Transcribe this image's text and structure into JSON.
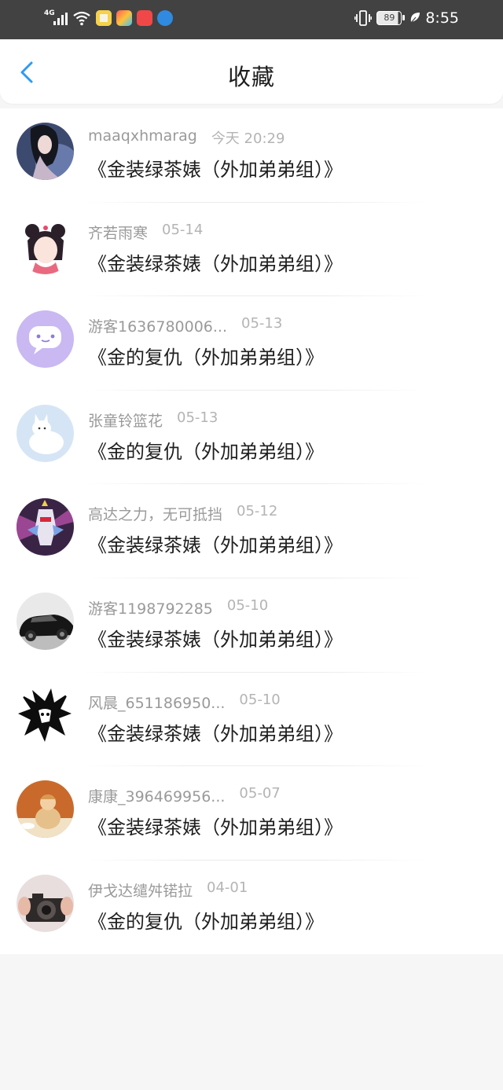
{
  "status_bar": {
    "network": "4G",
    "battery": "89",
    "time": "8:55",
    "icons": [
      "signal-icon",
      "wifi-icon",
      "app-icon-yellow",
      "app-icon-colorful",
      "app-icon-red",
      "app-icon-blue",
      "vibrate-icon",
      "battery-icon",
      "leaf-icon"
    ]
  },
  "header": {
    "title": "收藏",
    "back_icon": "chevron-left-icon"
  },
  "colors": {
    "accent": "#2f9bf0",
    "status_bar": "#424242",
    "page_background": "#f7f6f6"
  },
  "items": [
    {
      "user": "maaqxhmarag",
      "date": "今天 20:29",
      "title": "《金装绿茶婊（外加弟弟组）》",
      "avatar": "avatar-girl-photo"
    },
    {
      "user": "齐若雨寒",
      "date": "05-14",
      "title": "《金装绿茶婊（外加弟弟组）》",
      "avatar": "avatar-anime-girl"
    },
    {
      "user": "游客1636780006...",
      "date": "05-13",
      "title": "《金的复仇（外加弟弟组）》",
      "avatar": "avatar-chat-bubble"
    },
    {
      "user": "张童铃篮花",
      "date": "05-13",
      "title": "《金的复仇（外加弟弟组）》",
      "avatar": "avatar-white-fox"
    },
    {
      "user": "高达之力，无可抵挡",
      "date": "05-12",
      "title": "《金装绿茶婊（外加弟弟组）》",
      "avatar": "avatar-gundam"
    },
    {
      "user": "游客1198792285",
      "date": "05-10",
      "title": "《金装绿茶婊（外加弟弟组）》",
      "avatar": "avatar-black-car"
    },
    {
      "user": "风晨_651186950...",
      "date": "05-10",
      "title": "《金装绿茶婊（外加弟弟组）》",
      "avatar": "avatar-black-white-art"
    },
    {
      "user": "康康_396469956...",
      "date": "05-07",
      "title": "《金装绿茶婊（外加弟弟组）》",
      "avatar": "avatar-baby"
    },
    {
      "user": "伊戈达缱舛锘拉",
      "date": "04-01",
      "title": "《金的复仇（外加弟弟组）》",
      "avatar": "avatar-camera"
    }
  ]
}
